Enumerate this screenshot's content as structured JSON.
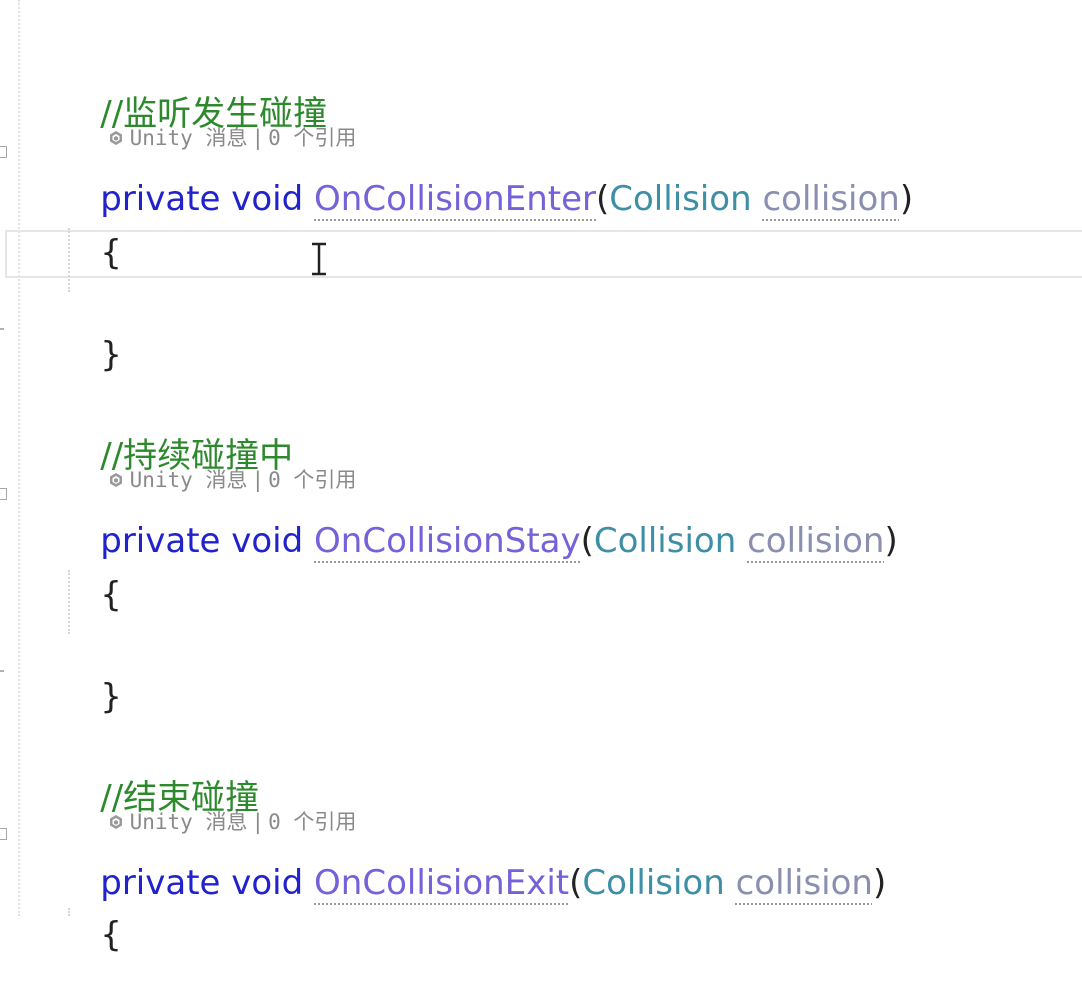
{
  "codelens": {
    "engine": "Unity",
    "message": "消息",
    "separator": "|",
    "refs": "0 个引用"
  },
  "blocks": [
    {
      "comment": "//监听发生碰撞",
      "keyword": "private void",
      "method": "OnCollisionEnter",
      "open_paren": "(",
      "param_type": "Collision",
      "param_name": "collision",
      "close_paren": ")",
      "open_brace": "{",
      "close_brace": "}"
    },
    {
      "comment": "//持续碰撞中",
      "keyword": "private void",
      "method": "OnCollisionStay",
      "open_paren": "(",
      "param_type": "Collision",
      "param_name": "collision",
      "close_paren": ")",
      "open_brace": "{",
      "close_brace": "}"
    },
    {
      "comment": "//结束碰撞",
      "keyword": "private void",
      "method": "OnCollisionExit",
      "open_paren": "(",
      "param_type": "Collision",
      "param_name": "collision",
      "close_paren": ")",
      "open_brace": "{"
    }
  ],
  "icons": {
    "codelens": "unity-cube-icon",
    "cursor": "text-cursor-ibeam-icon",
    "collapse": "collapse-marker-icon"
  },
  "colors": {
    "comment": "#2c8a2c",
    "keyword": "#2222cc",
    "method": "#7462d8",
    "type": "#3e8fa6",
    "parameter": "#8a8fb0",
    "codelens": "#8a8a8a"
  }
}
